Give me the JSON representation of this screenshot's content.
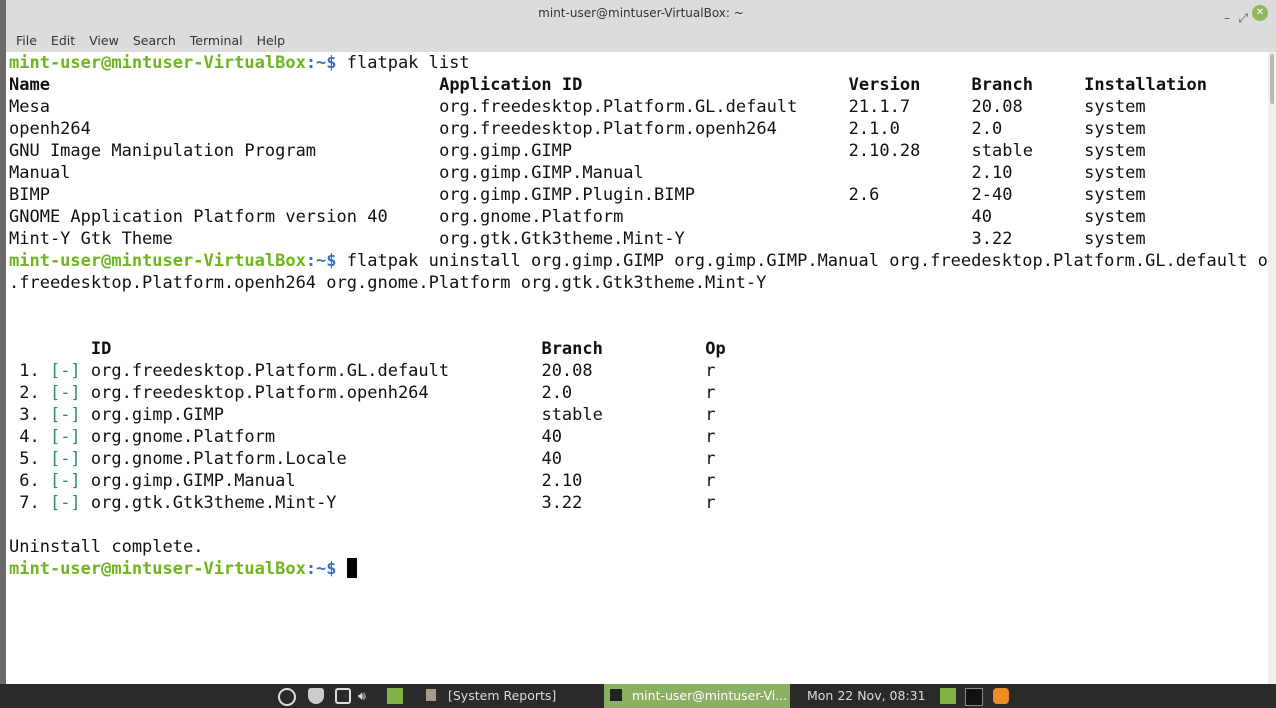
{
  "window": {
    "title": "mint-user@mintuser-VirtualBox: ~"
  },
  "menu": [
    "File",
    "Edit",
    "View",
    "Search",
    "Terminal",
    "Help"
  ],
  "prompt": {
    "user": "mint-user@mintuser-VirtualBox",
    "path": ":~$ "
  },
  "commands": [
    "flatpak list",
    "flatpak uninstall org.gimp.GIMP org.gimp.GIMP.Manual org.freedesktop.Platform.GL.default org",
    ".freedesktop.Platform.openh264 org.gnome.Platform org.gtk.Gtk3theme.Mint-Y"
  ],
  "list": {
    "headers": [
      "Name",
      "Application ID",
      "Version",
      "Branch",
      "Installation"
    ],
    "rows": [
      [
        "Mesa",
        "org.freedesktop.Platform.GL.default",
        "21.1.7",
        "20.08",
        "system"
      ],
      [
        "openh264",
        "org.freedesktop.Platform.openh264",
        "2.1.0",
        "2.0",
        "system"
      ],
      [
        "GNU Image Manipulation Program",
        "org.gimp.GIMP",
        "2.10.28",
        "stable",
        "system"
      ],
      [
        "Manual",
        "org.gimp.GIMP.Manual",
        "",
        "2.10",
        "system"
      ],
      [
        "BIMP",
        "org.gimp.GIMP.Plugin.BIMP",
        "2.6",
        "2-40",
        "system"
      ],
      [
        "GNOME Application Platform version 40",
        "org.gnome.Platform",
        "",
        "40",
        "system"
      ],
      [
        "Mint-Y Gtk Theme",
        "org.gtk.Gtk3theme.Mint-Y",
        "",
        "3.22",
        "system"
      ]
    ]
  },
  "uninstall": {
    "headers": [
      "ID",
      "Branch",
      "Op"
    ],
    "mark": "[-]",
    "rows": [
      [
        "1.",
        "org.freedesktop.Platform.GL.default",
        "20.08",
        "r"
      ],
      [
        "2.",
        "org.freedesktop.Platform.openh264",
        "2.0",
        "r"
      ],
      [
        "3.",
        "org.gimp.GIMP",
        "stable",
        "r"
      ],
      [
        "4.",
        "org.gnome.Platform",
        "40",
        "r"
      ],
      [
        "5.",
        "org.gnome.Platform.Locale",
        "40",
        "r"
      ],
      [
        "6.",
        "org.gimp.GIMP.Manual",
        "2.10",
        "r"
      ],
      [
        "7.",
        "org.gtk.Gtk3theme.Mint-Y",
        "3.22",
        "r"
      ]
    ],
    "complete": "Uninstall complete."
  },
  "taskbar": {
    "system_reports": "[System Reports]",
    "terminal": "mint-user@mintuser-Vi...",
    "clock": "Mon 22 Nov, 08:31"
  }
}
